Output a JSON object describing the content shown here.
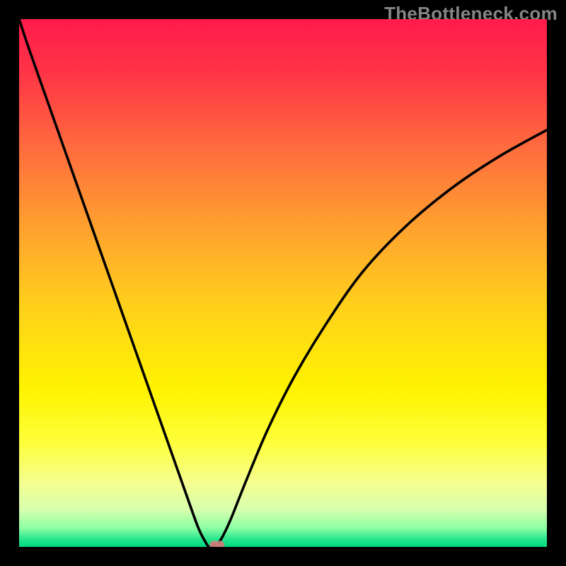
{
  "watermark": "TheBottleneck.com",
  "chart_data": {
    "type": "line",
    "title": "",
    "xlabel": "",
    "ylabel": "",
    "xlim": [
      0,
      100
    ],
    "ylim": [
      0,
      100
    ],
    "grid": false,
    "legend": false,
    "annotations": [],
    "series": [
      {
        "name": "bottleneck-curve",
        "color": "#000000",
        "x": [
          0,
          2,
          5,
          8,
          11,
          14,
          17,
          20,
          23,
          26,
          29,
          32,
          34,
          35.5,
          36,
          36.7,
          37.5,
          38.3,
          40,
          43,
          47,
          52,
          58,
          65,
          73,
          82,
          91,
          100
        ],
        "y": [
          100,
          94,
          85.5,
          77,
          68.5,
          60,
          51.5,
          43,
          34.5,
          26,
          17.5,
          9,
          3.5,
          0.6,
          0,
          0,
          0.6,
          1.5,
          5,
          12.5,
          22,
          32,
          42,
          52,
          60.5,
          68,
          74,
          79
        ]
      }
    ],
    "marker": {
      "x": 37.5,
      "y": 0.3,
      "color": "#d47a7a"
    },
    "background_gradient": {
      "type": "linear-vertical",
      "stops": [
        {
          "offset": 0.0,
          "color": "#ff1b4a"
        },
        {
          "offset": 0.1,
          "color": "#ff3447"
        },
        {
          "offset": 0.25,
          "color": "#ff6e3d"
        },
        {
          "offset": 0.4,
          "color": "#ffa32e"
        },
        {
          "offset": 0.55,
          "color": "#ffd21a"
        },
        {
          "offset": 0.7,
          "color": "#fff300"
        },
        {
          "offset": 0.8,
          "color": "#feff38"
        },
        {
          "offset": 0.88,
          "color": "#f4ff91"
        },
        {
          "offset": 0.93,
          "color": "#d7ffae"
        },
        {
          "offset": 0.965,
          "color": "#8affa3"
        },
        {
          "offset": 0.985,
          "color": "#28e68e"
        },
        {
          "offset": 1.0,
          "color": "#00d880"
        }
      ]
    }
  }
}
